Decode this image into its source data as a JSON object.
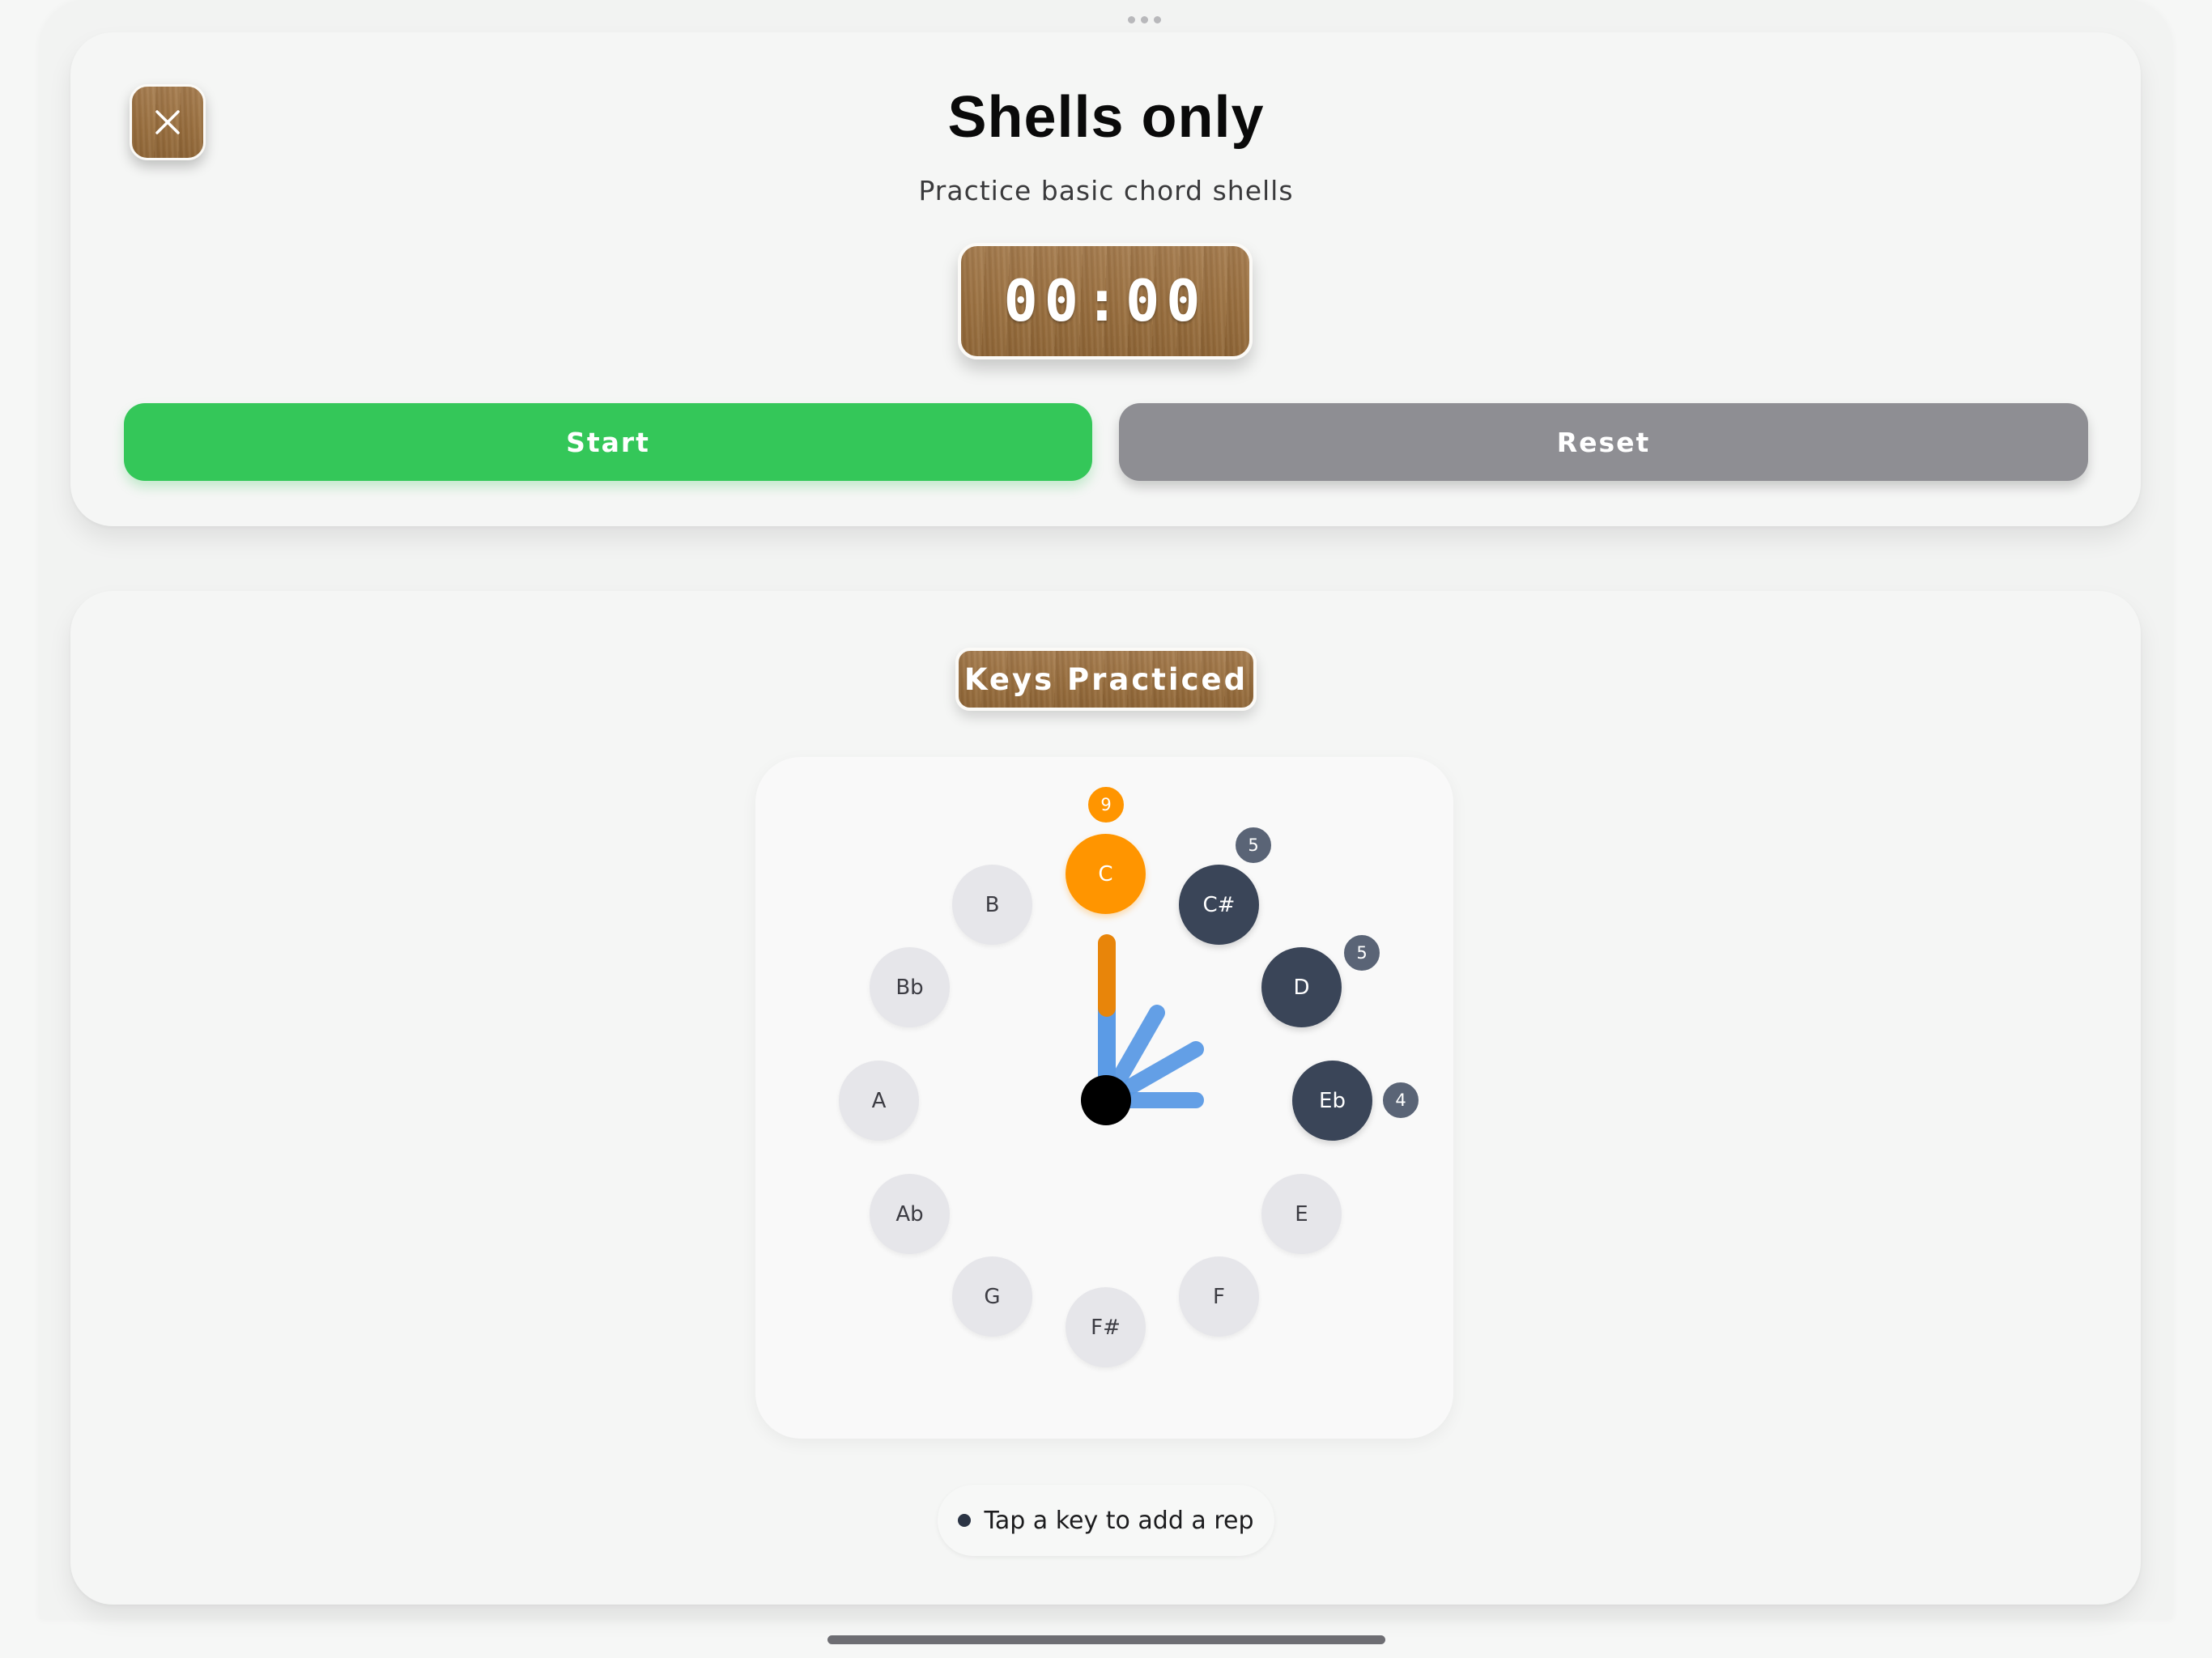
{
  "sheet": {
    "close_icon": "close-icon",
    "title": "Shells only",
    "subtitle": "Practice basic chord shells",
    "timer": "00:00",
    "start_label": "Start",
    "reset_label": "Reset"
  },
  "practice": {
    "section_label": "Keys Practiced",
    "hint": "Tap a key to add a rep",
    "keys": [
      {
        "label": "C",
        "reps": 9,
        "state": "current"
      },
      {
        "label": "C#",
        "reps": 5,
        "state": "practiced"
      },
      {
        "label": "D",
        "reps": 5,
        "state": "practiced"
      },
      {
        "label": "Eb",
        "reps": 4,
        "state": "practiced"
      },
      {
        "label": "E",
        "state": "unpracticed"
      },
      {
        "label": "F",
        "state": "unpracticed"
      },
      {
        "label": "F#",
        "state": "unpracticed"
      },
      {
        "label": "G",
        "state": "unpracticed"
      },
      {
        "label": "Ab",
        "state": "unpracticed"
      },
      {
        "label": "A",
        "state": "unpracticed"
      },
      {
        "label": "Bb",
        "state": "unpracticed"
      },
      {
        "label": "B",
        "state": "unpracticed"
      }
    ]
  },
  "colors": {
    "accent_green": "#34c759",
    "neutral_gray": "#8e8e93",
    "current_orange": "#ff9500",
    "practiced_dark": "#3a4558",
    "hand_blue": "#5b9be6",
    "hand_orange": "#e8850a"
  }
}
